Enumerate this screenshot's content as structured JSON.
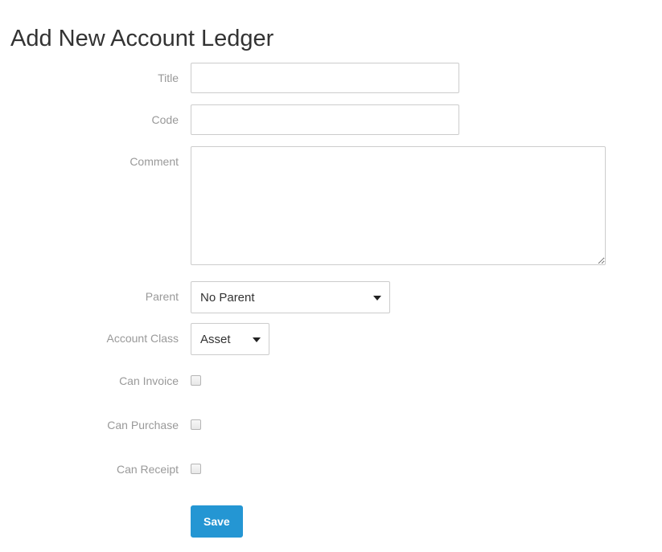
{
  "page": {
    "title": "Add New Account Ledger"
  },
  "form": {
    "fields": [
      {
        "label": "Title",
        "value": "",
        "placeholder": "",
        "type": "text"
      },
      {
        "label": "Code",
        "value": "",
        "placeholder": "",
        "type": "text"
      },
      {
        "label": "Comment",
        "value": "",
        "placeholder": "",
        "type": "textarea"
      },
      {
        "label": "Parent",
        "value": "No Parent",
        "type": "select",
        "options": [
          "No Parent"
        ]
      },
      {
        "label": "Account Class",
        "value": "Asset",
        "type": "select",
        "options": [
          "Asset"
        ]
      },
      {
        "label": "Can Invoice",
        "checked": false,
        "type": "checkbox"
      },
      {
        "label": "Can Purchase",
        "checked": false,
        "type": "checkbox"
      },
      {
        "label": "Can Receipt",
        "checked": false,
        "type": "checkbox"
      }
    ],
    "save_label": "Save"
  },
  "colors": {
    "accent": "#2496d3",
    "label_text": "#999999",
    "title_text": "#333333",
    "border": "#cccccc"
  }
}
